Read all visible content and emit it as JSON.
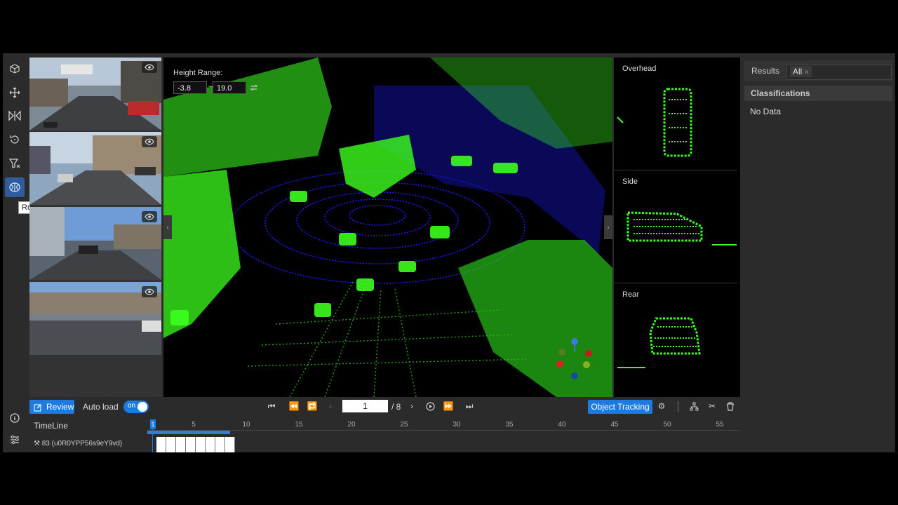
{
  "toolbar": {
    "tools": [
      {
        "icon": "cube-icon"
      },
      {
        "icon": "move-icon"
      },
      {
        "icon": "flip-icon"
      },
      {
        "icon": "rotate-icon"
      },
      {
        "icon": "filter-icon"
      },
      {
        "icon": "brain-icon",
        "active": true
      }
    ],
    "tooltip": "Run Model",
    "bottom_icons": [
      "info-icon",
      "sliders-icon"
    ]
  },
  "cameras": [
    {
      "name": "camera-1",
      "visible": true
    },
    {
      "name": "camera-2",
      "visible": true
    },
    {
      "name": "camera-3",
      "visible": true
    },
    {
      "name": "camera-4",
      "visible": true
    }
  ],
  "viewer": {
    "height_range_label": "Height Range:",
    "height_min": "-3.8",
    "separator": "~",
    "height_max": "19.0"
  },
  "views": {
    "overhead": "Overhead",
    "side": "Side",
    "rear": "Rear"
  },
  "results": {
    "label": "Results",
    "filter_tag": "All",
    "classifications_header": "Classifications",
    "empty_text": "No Data"
  },
  "bottombar": {
    "review_label": "Review",
    "auto_load_label": "Auto load",
    "toggle_label": "on",
    "frame_value": "1",
    "frame_total": "/ 8",
    "object_tracking_label": "Object Tracking"
  },
  "timeline": {
    "label": "TimeLine",
    "cursor": "1",
    "ticks": [
      "5",
      "10",
      "15",
      "20",
      "25",
      "30",
      "35",
      "40",
      "45",
      "50",
      "55"
    ],
    "object_label": "83 (u0R0YPP56s9eY9vd)",
    "frame_count": 8
  },
  "colors": {
    "accent": "#1f7ae0",
    "point_green": "#3cff1e",
    "point_blue": "#1a1aff"
  }
}
